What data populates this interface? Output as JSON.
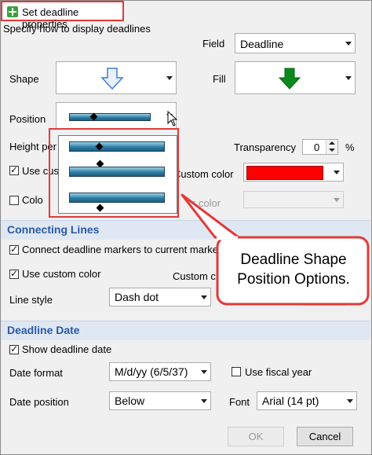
{
  "title": "Set deadline properties",
  "subtitle": "Specify how to display deadlines",
  "field": {
    "label": "Field",
    "value": "Deadline"
  },
  "shape": {
    "label": "Shape",
    "icon": "down-arrow-outline-icon"
  },
  "fill": {
    "label": "Fill",
    "icon": "green-down-arrow-icon",
    "color": "#0a8a1a"
  },
  "position": {
    "label": "Position"
  },
  "height_label": "Height per",
  "transparency": {
    "label": "Transparency",
    "value": "0",
    "unit": "%"
  },
  "use_custom_label": "Use cus",
  "custom_color_label": "Custom color",
  "custom_color_value": "#ff0000",
  "color_label": "Colo",
  "by_color_label": "r",
  "second_color_label": "r color",
  "connecting": {
    "header": "Connecting Lines",
    "connect_label": "Connect deadline markers to current marker",
    "use_custom_label": "Use custom color",
    "custom_label": "Custom co",
    "line_style_label": "Line style",
    "line_style_value": "Dash dot"
  },
  "deadline_date": {
    "header": "Deadline Date",
    "show_label": "Show deadline date",
    "date_format_label": "Date format",
    "date_format_value": "M/d/yy (6/5/37)",
    "fiscal_label": "Use fiscal year",
    "date_position_label": "Date position",
    "date_position_value": "Below",
    "font_label": "Font",
    "font_value": "Arial (14 pt)"
  },
  "buttons": {
    "ok": "OK",
    "cancel": "Cancel"
  },
  "callout": "Deadline Shape Position Options.",
  "accent_red": "#e23a3a"
}
